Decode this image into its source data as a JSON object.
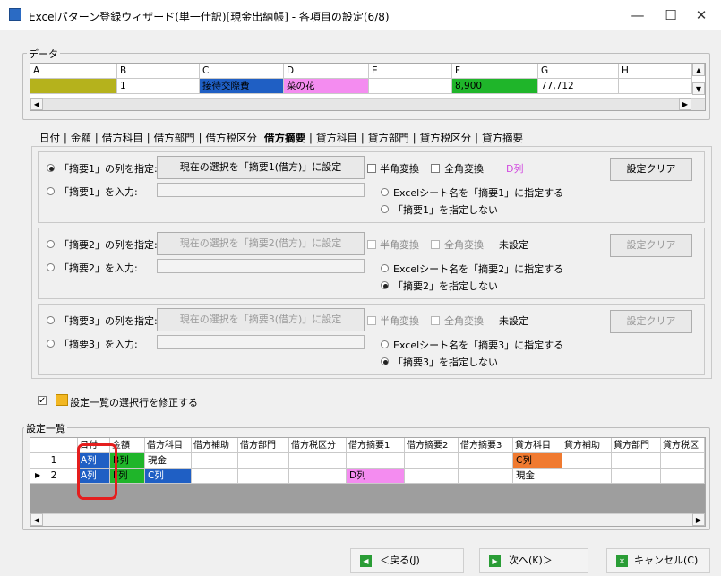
{
  "window": {
    "title": "Excelパターン登録ウィザード(単一仕訳)[現金出納帳] - 各項目の設定(6/8)",
    "minimize": "—",
    "maximize": "☐",
    "close": "✕"
  },
  "data_group": {
    "legend": "データ",
    "columns": [
      "A",
      "B",
      "C",
      "D",
      "E",
      "F",
      "G",
      "H"
    ],
    "row": [
      "",
      "1",
      "接待交際費",
      "菜の花",
      "",
      "8,900",
      "77,712",
      ""
    ],
    "colors": {
      "A": "#b5b21c",
      "C": "#1f5fc4",
      "D": "#f48cf0",
      "F": "#1fb52a"
    }
  },
  "tabs": [
    "日付",
    "金額",
    "借方科目",
    "借方部門",
    "借方税区分",
    "借方摘要",
    "貸方科目",
    "貸方部門",
    "貸方税区分",
    "貸方摘要"
  ],
  "active_tab": "借方摘要",
  "blocks": [
    {
      "radio_col": "「摘要1」の列を指定:",
      "radio_input": "「摘要1」を入力:",
      "set_button": "現在の選択を「摘要1(借方)」に設定",
      "half": "半角変換",
      "full": "全角変換",
      "status": "D列",
      "opt_sheet": "Excelシート名を「摘要1」に指定する",
      "opt_none": "「摘要1」を指定しない",
      "clear": "設定クリア"
    },
    {
      "radio_col": "「摘要2」の列を指定:",
      "radio_input": "「摘要2」を入力:",
      "set_button": "現在の選択を「摘要2(借方)」に設定",
      "half": "半角変換",
      "full": "全角変換",
      "status": "未設定",
      "opt_sheet": "Excelシート名を「摘要2」に指定する",
      "opt_none": "「摘要2」を指定しない",
      "clear": "設定クリア"
    },
    {
      "radio_col": "「摘要3」の列を指定:",
      "radio_input": "「摘要3」を入力:",
      "set_button": "現在の選択を「摘要3(借方)」に設定",
      "half": "半角変換",
      "full": "全角変換",
      "status": "未設定",
      "opt_sheet": "Excelシート名を「摘要3」に指定する",
      "opt_none": "「摘要3」を指定しない",
      "clear": "設定クリア"
    }
  ],
  "modify_checkbox": "設定一覧の選択行を修正する",
  "settings_group": {
    "legend": "設定一覧",
    "headers": [
      "",
      "日付",
      "金額",
      "借方科目",
      "借方補助",
      "借方部門",
      "借方税区分",
      "借方摘要1",
      "借方摘要2",
      "借方摘要3",
      "貸方科目",
      "貸方補助",
      "貸方部門",
      "貸方税区"
    ],
    "rows": [
      [
        "1",
        "A列",
        "B列",
        "現金",
        "",
        "",
        "",
        "",
        "",
        "",
        "C列",
        "",
        "",
        ""
      ],
      [
        "2",
        "A列",
        "F列",
        "C列",
        "",
        "",
        "",
        "D列",
        "",
        "",
        "現金",
        "",
        "",
        ""
      ]
    ]
  },
  "footer": {
    "back": "＜戻る(J)",
    "next": "次へ(K)＞",
    "cancel": "キャンセル(C)"
  },
  "colors": {
    "accent_red": "#e41e1e",
    "blue": "#1f5fc4",
    "green": "#1fb52a",
    "pink": "#f48cf0",
    "orange": "#f07a30",
    "magenta": "#d24de0"
  }
}
